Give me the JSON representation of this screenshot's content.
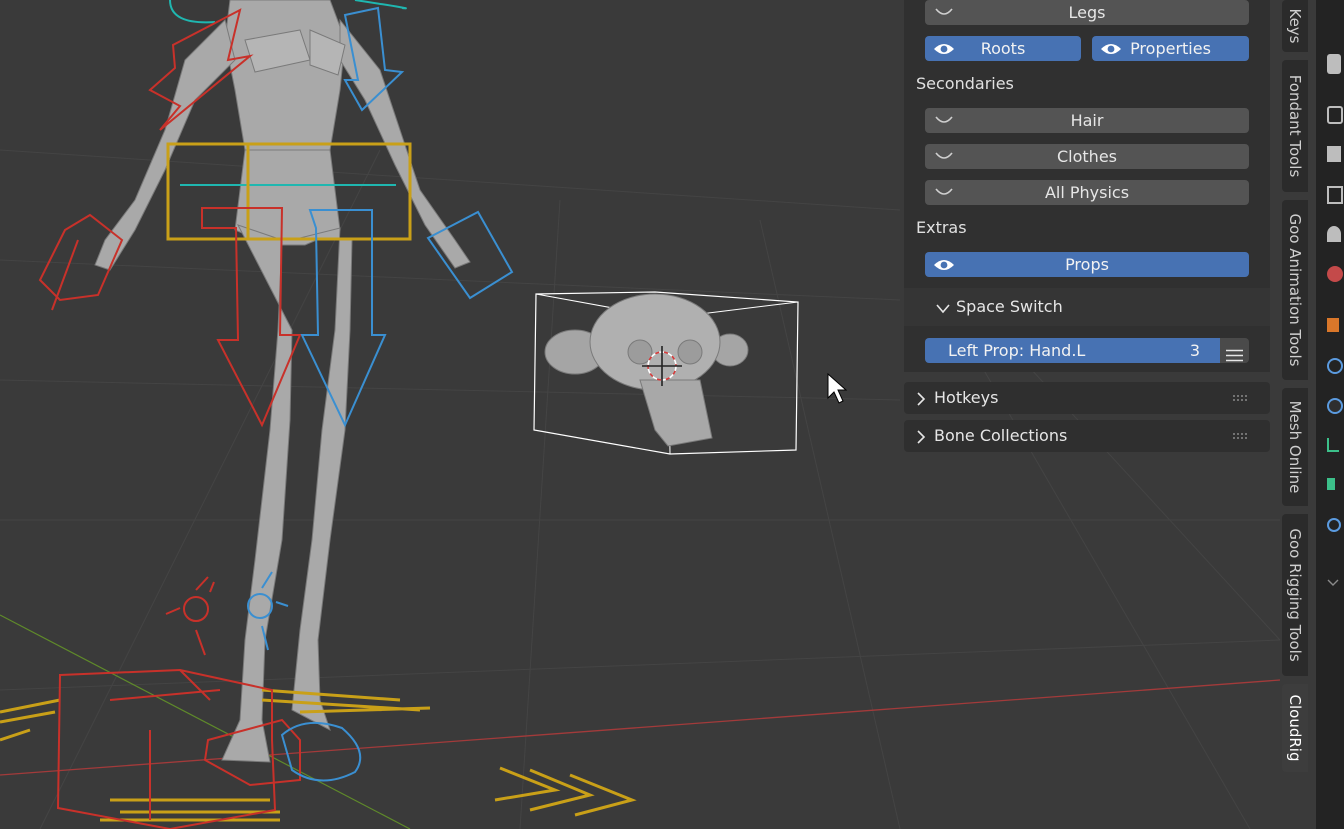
{
  "panel": {
    "legs_label": "Legs",
    "roots_label": "Roots",
    "properties_label": "Properties",
    "secondaries_heading": "Secondaries",
    "hair_label": "Hair",
    "clothes_label": "Clothes",
    "all_physics_label": "All Physics",
    "extras_heading": "Extras",
    "props_label": "Props",
    "space_switch_label": "Space Switch",
    "left_prop_label": "Left Prop: Hand.L",
    "left_prop_value": "3",
    "hotkeys_label": "Hotkeys",
    "bone_collections_label": "Bone Collections"
  },
  "tabs": [
    {
      "label": "Keys"
    },
    {
      "label": "Fondant Tools"
    },
    {
      "label": "Goo Animation Tools"
    },
    {
      "label": "Mesh Online"
    },
    {
      "label": "Goo Rigging Tools"
    },
    {
      "label": "CloudRig"
    }
  ],
  "icons": {
    "visibility": "eye-icon",
    "collapsed_visibility": "eye-closed-icon",
    "menu": "hamburger-icon",
    "expand": "chevron-down-icon",
    "collapse": "chevron-right-icon",
    "grip": "drag-grip-icon"
  },
  "colors": {
    "viewport_bg": "#3a3a3a",
    "accent_blue": "#4772b3",
    "bone_red": "#c8312a",
    "bone_blue": "#3a8fd1",
    "bone_yellow": "#c9a018",
    "bone_teal": "#1fb7b0"
  }
}
